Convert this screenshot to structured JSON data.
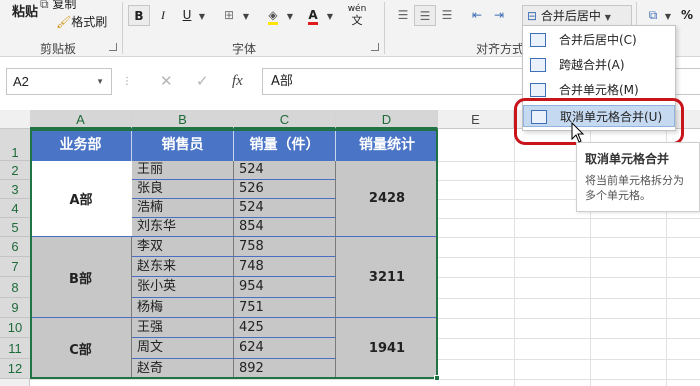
{
  "ribbon": {
    "clipboard": {
      "paste_label": "粘贴",
      "copy_label": "复制",
      "format_painter_label": "格式刷",
      "group_label": "剪贴板"
    },
    "font": {
      "group_label": "字体",
      "bold": "B",
      "italic": "I",
      "underline": "U",
      "phonetic_label": "wén"
    },
    "alignment": {
      "group_label": "对齐方式",
      "merge_button_label": "合并后居中"
    },
    "number": {
      "percent_label": "%"
    }
  },
  "formula_bar": {
    "name_box": "A2",
    "cancel": "✕",
    "enter": "✓",
    "fx": "fx",
    "formula": "A部"
  },
  "columns": [
    "A",
    "B",
    "C",
    "D",
    "E"
  ],
  "rows": [
    "1",
    "2",
    "3",
    "4",
    "5",
    "6",
    "7",
    "8",
    "9",
    "10",
    "11",
    "12"
  ],
  "table": {
    "headers": [
      "业务部",
      "销售员",
      "销量（件）",
      "销量统计"
    ],
    "groups": [
      {
        "dept": "A部",
        "total": "2428",
        "rows": [
          [
            "王丽",
            "524"
          ],
          [
            "张良",
            "526"
          ],
          [
            "浩楠",
            "524"
          ],
          [
            "刘东华",
            "854"
          ]
        ]
      },
      {
        "dept": "B部",
        "total": "3211",
        "rows": [
          [
            "李双",
            "758"
          ],
          [
            "赵东来",
            "748"
          ],
          [
            "张小英",
            "954"
          ],
          [
            "杨梅",
            "751"
          ]
        ]
      },
      {
        "dept": "C部",
        "total": "1941",
        "rows": [
          [
            "王强",
            "425"
          ],
          [
            "周文",
            "624"
          ],
          [
            "赵奇",
            "892"
          ]
        ]
      }
    ]
  },
  "merge_menu": {
    "items": [
      {
        "label": "合并后居中(C)",
        "icon": "merge-center-icon"
      },
      {
        "label": "跨越合并(A)",
        "icon": "merge-across-icon"
      },
      {
        "label": "合并单元格(M)",
        "icon": "merge-cells-icon"
      },
      {
        "label": "取消单元格合并(U)",
        "icon": "unmerge-cells-icon"
      }
    ]
  },
  "tooltip": {
    "title": "取消单元格合并",
    "description": "将当前单元格拆分为多个单元格。"
  },
  "colors": {
    "header_blue": "#4a74c6",
    "excel_green": "#217346",
    "highlight_red": "#c8141b",
    "cell_grey": "#c7c7c7"
  }
}
